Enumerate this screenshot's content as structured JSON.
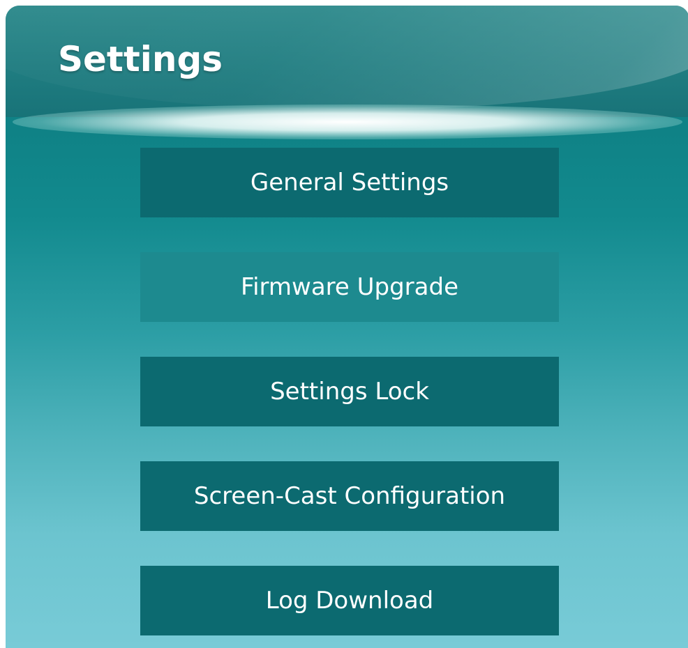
{
  "header": {
    "title": "Settings"
  },
  "menu": {
    "items": [
      {
        "label": "General Settings",
        "selected": false
      },
      {
        "label": "Firmware Upgrade",
        "selected": true
      },
      {
        "label": "Settings Lock",
        "selected": false
      },
      {
        "label": "Screen-Cast Configuration",
        "selected": false
      },
      {
        "label": "Log Download",
        "selected": false
      }
    ]
  },
  "colors": {
    "button": "#0c6a70",
    "button_selected": "#1d8a8f",
    "background_top": "#0e7f82",
    "background_bottom": "#78cbd7",
    "text": "#ffffff"
  }
}
